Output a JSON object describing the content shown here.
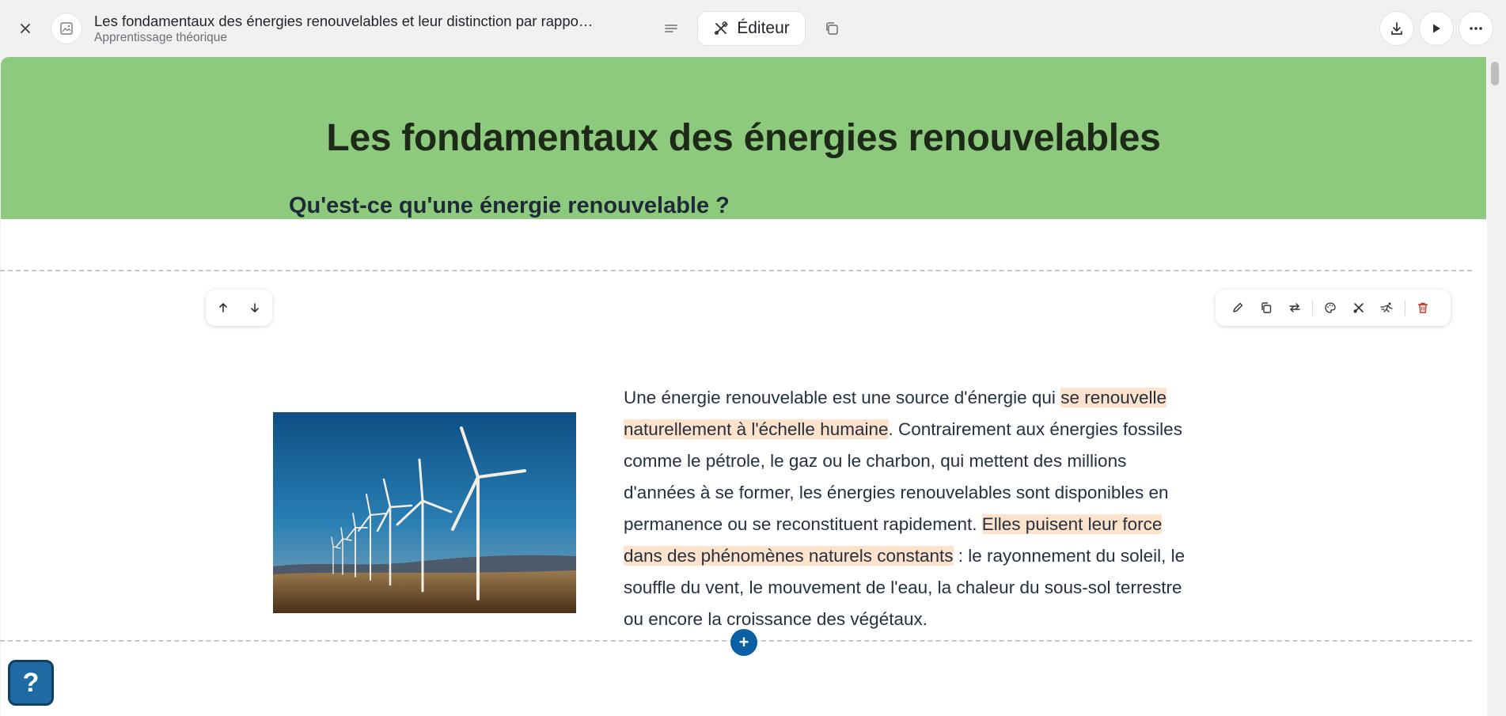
{
  "header": {
    "title": "Les fondamentaux des énergies renouvelables et leur distinction par rappo…",
    "subtitle": "Apprentissage théorique",
    "editor_label": "Éditeur"
  },
  "page": {
    "banner_title": "Les fondamentaux des énergies renouvelables",
    "section_heading": "Qu'est-ce qu'une énergie renouvelable ?",
    "paragraph": [
      {
        "text": "Une énergie renouvelable est une source d'énergie qui ",
        "highlight": false
      },
      {
        "text": "se renouvelle naturellement à l'échelle humaine",
        "highlight": true
      },
      {
        "text": ". Contrairement aux énergies fossiles comme le pétrole, le gaz ou le charbon, qui mettent des millions d'années à se former, les énergies renouvelables sont disponibles en permanence ou se reconstituent rapidement. ",
        "highlight": false
      },
      {
        "text": "Elles puisent leur force dans des phénomènes naturels constants",
        "highlight": true
      },
      {
        "text": " : le rayonnement du soleil, le souffle du vent, le mouvement de l'eau, la chaleur du sous-sol terrestre ou encore la croissance des végétaux.",
        "highlight": false
      }
    ],
    "image_subject": "wind-turbines-photo"
  },
  "controls": {
    "add_label": "+",
    "help_label": "?"
  },
  "colors": {
    "banner": "#8dca7d",
    "highlight": "#fde2cc",
    "accent": "#0b5fa5",
    "delete": "#c0392b"
  }
}
